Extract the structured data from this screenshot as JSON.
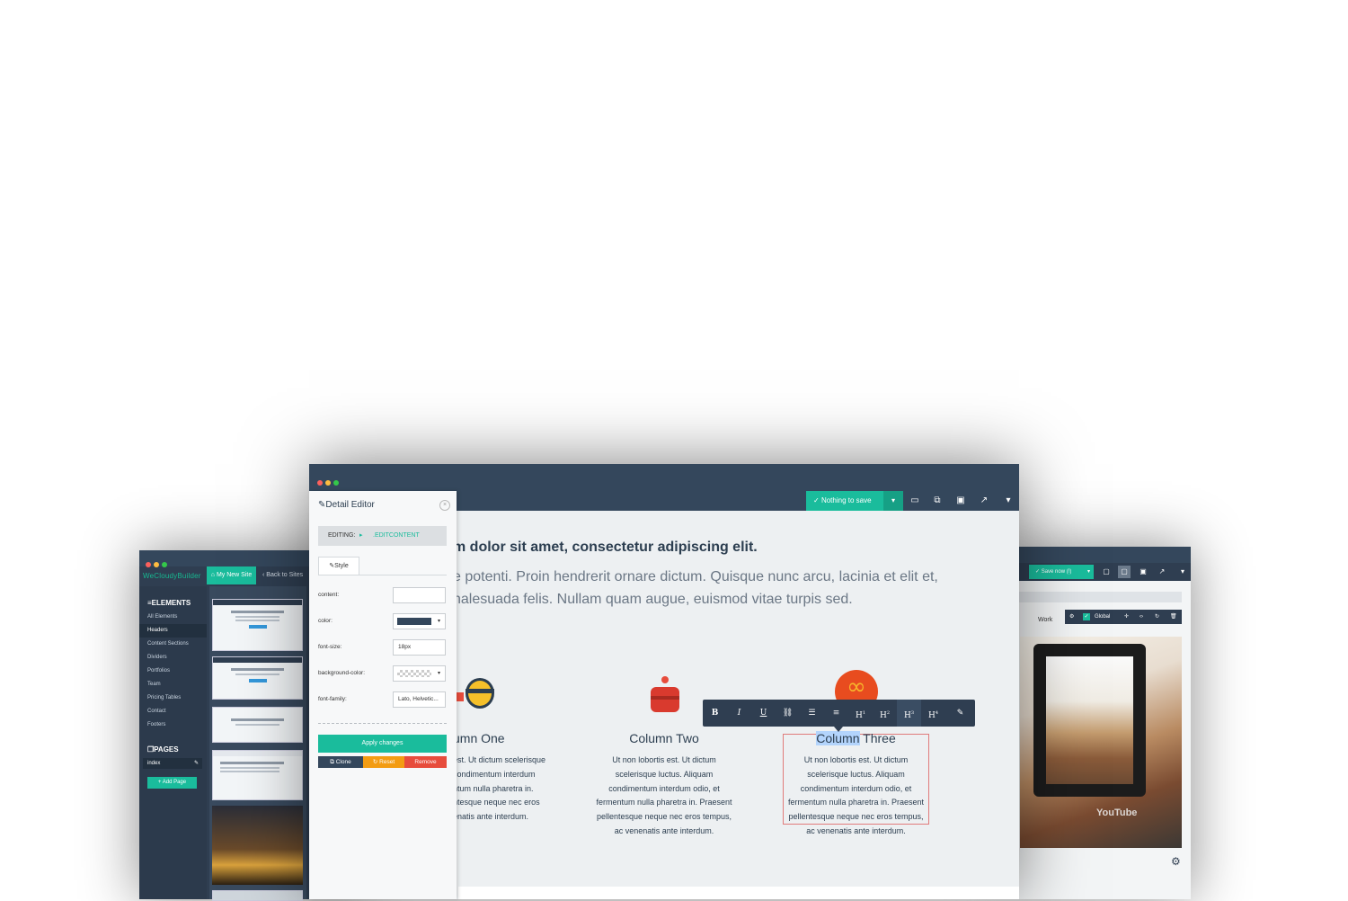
{
  "left_window": {
    "brand": "WeCloudyBuilder",
    "site_button": "My New Site",
    "back_link": "Back to Sites",
    "elements_heading": "ELEMENTS",
    "element_items": [
      "All Elements",
      "Headers",
      "Content Sections",
      "Dividers",
      "Portfolios",
      "Team",
      "Pricing Tables",
      "Contact",
      "Footers"
    ],
    "pages_heading": "PAGES",
    "page_item": "index",
    "add_page": "+ Add Page"
  },
  "main_window": {
    "save_status": "Nothing to save",
    "heading": "m dolor sit amet, consectetur adipiscing elit.",
    "paragraph": "e potenti. Proin hendrerit ornare dictum. Quisque nunc arcu, lacinia et elit et, nalesuada felis. Nullam quam augue, euismod vitae turpis sed.",
    "columns": [
      {
        "title": "umn One",
        "text": "est. Ut dictum scelerisque condimentum interdum ntum nulla pharetra in. ntesque neque nec eros enatis ante interdum."
      },
      {
        "title": "Column Two",
        "text": "Ut non lobortis est. Ut dictum scelerisque luctus. Aliquam condimentum interdum odio, et fermentum nulla pharetra in. Praesent pellentesque neque nec eros tempus, ac venenatis ante interdum."
      },
      {
        "title_selected": "Column",
        "title_rest": " Three",
        "text": "Ut non lobortis est. Ut dictum scelerisque luctus. Aliquam condimentum interdum odio, et fermentum nulla pharetra in. Praesent pellentesque neque nec eros tempus, ac venenatis ante interdum."
      }
    ],
    "format_toolbar": [
      "B",
      "I",
      "U",
      "link",
      "ol",
      "ul",
      "H1",
      "H2",
      "H3",
      "H4",
      "eraser"
    ]
  },
  "detail_editor": {
    "title": "Detail Editor",
    "editing_label": "EDITING:",
    "editing_target": ".EDITCONTENT",
    "tab": "Style",
    "fields": {
      "content_label": "content:",
      "content_value": "",
      "color_label": "color:",
      "color_value": "#34475c",
      "font_size_label": "font-size:",
      "font_size_value": "18px",
      "background_color_label": "background-color:",
      "font_family_label": "font-family:",
      "font_family_value": "Lato, Helvetic..."
    },
    "apply": "Apply changes",
    "clone": "Clone",
    "reset": "Reset",
    "remove": "Remove"
  },
  "right_window": {
    "save_status": "Save now (!)",
    "nav_item": "Work",
    "global_label": "Global",
    "video_brand": "YouTube"
  },
  "colors": {
    "accent": "#1abc9c",
    "dark": "#2f3e51",
    "reset": "#f39c12",
    "remove": "#e74c3c"
  }
}
